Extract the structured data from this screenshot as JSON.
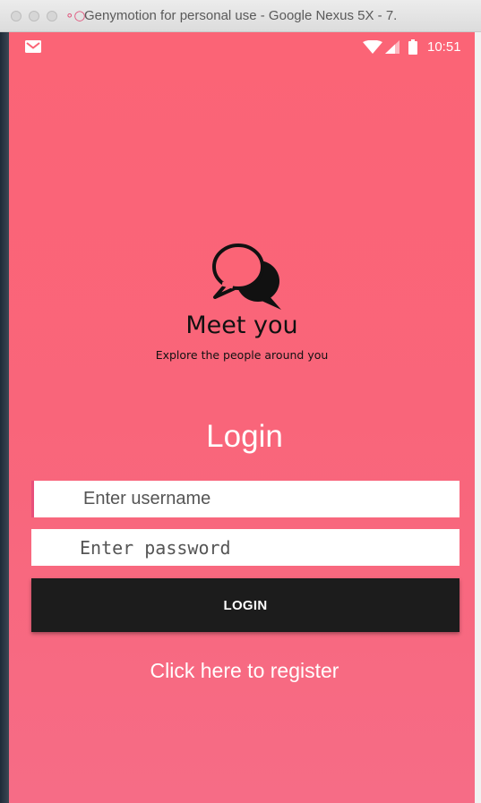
{
  "window": {
    "title": "Genymotion for personal use - Google Nexus 5X - 7.",
    "app_icon": "genymotion-icon"
  },
  "status_bar": {
    "time": "10:51",
    "icons": [
      "gmail-icon",
      "wifi-icon",
      "signal-icon",
      "battery-icon"
    ]
  },
  "branding": {
    "app_name": "Meet you",
    "tagline": "Explore the people around you",
    "logo_icon": "chat-bubbles-icon"
  },
  "login": {
    "title": "Login",
    "username_placeholder": "Enter username",
    "password_placeholder": "Enter password",
    "button_label": "LOGIN",
    "register_link": "Click here to register"
  },
  "colors": {
    "background": "#fb6476",
    "button": "#1c1c1c",
    "accent": "#e84f7a"
  }
}
